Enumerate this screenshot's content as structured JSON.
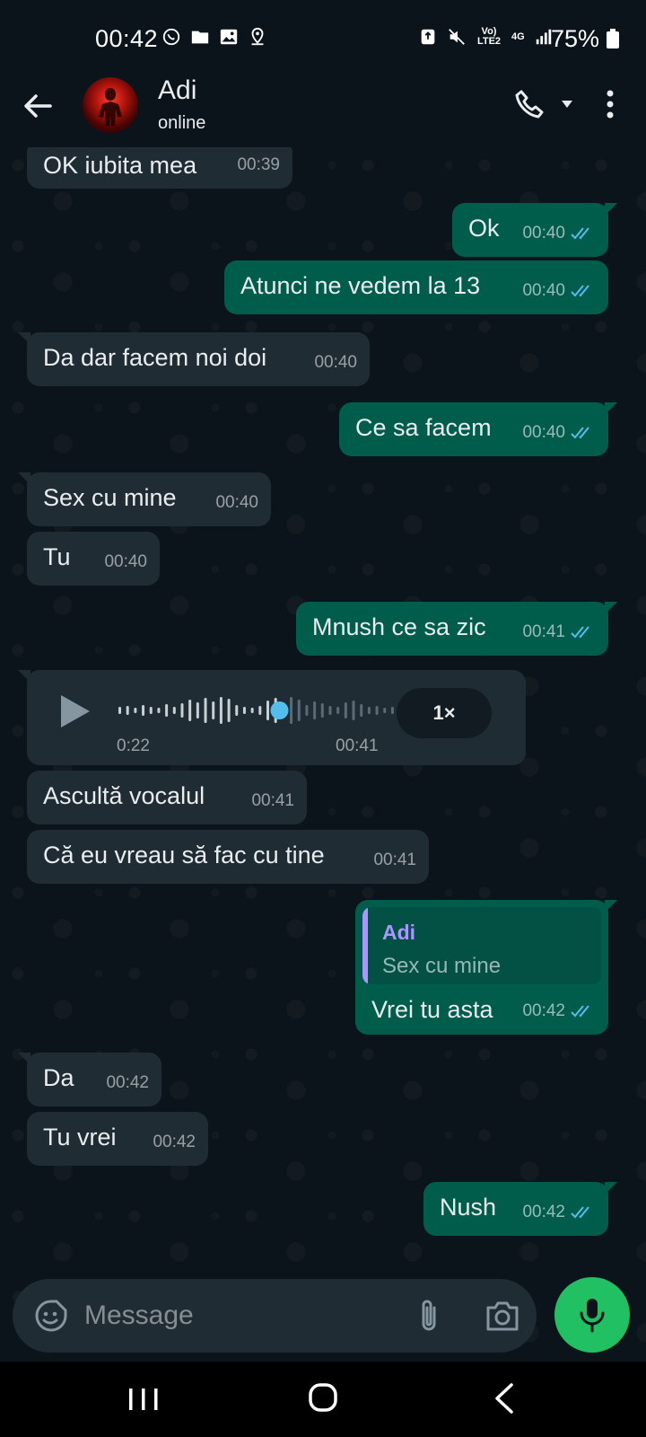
{
  "status_bar": {
    "time": "00:42",
    "battery": "75%",
    "network_label": "Vo) LTE2",
    "network_type": "4G",
    "icons_left": [
      "whatsapp-icon",
      "folder-icon",
      "gallery-icon",
      "location-icon"
    ],
    "icons_right": [
      "recycle-icon",
      "mute-icon",
      "signal-icon",
      "battery-icon"
    ]
  },
  "header": {
    "contact_name": "Adi",
    "contact_status": "online"
  },
  "messages": [
    {
      "dir": "in",
      "text": "OK iubita mea",
      "time": "00:39"
    },
    {
      "dir": "out",
      "text": "Ok",
      "time": "00:40"
    },
    {
      "dir": "out",
      "text": "Atunci ne vedem la 13",
      "time": "00:40"
    },
    {
      "dir": "in",
      "text": "Da dar facem noi doi",
      "time": "00:40"
    },
    {
      "dir": "out",
      "text": "Ce sa facem",
      "time": "00:40"
    },
    {
      "dir": "in",
      "text": "Sex cu mine",
      "time": "00:40"
    },
    {
      "dir": "in",
      "text": "Tu",
      "time": "00:40"
    },
    {
      "dir": "out",
      "text": "Mnush ce sa zic",
      "time": "00:41"
    },
    {
      "dir": "in",
      "text": "Ascultă vocalul",
      "time": "00:41"
    },
    {
      "dir": "in",
      "text": "Că eu vreau să fac cu tine",
      "time": "00:41"
    },
    {
      "dir": "out",
      "text": "Vrei tu asta",
      "time": "00:42"
    },
    {
      "dir": "in",
      "text": "Da",
      "time": "00:42"
    },
    {
      "dir": "in",
      "text": "Tu vrei",
      "time": "00:42"
    },
    {
      "dir": "out",
      "text": "Nush",
      "time": "00:42"
    }
  ],
  "voice_message": {
    "duration": "0:22",
    "time": "00:41",
    "speed": "1×",
    "progress": 0.55
  },
  "reply_quote": {
    "author": "Adi",
    "text": "Sex cu mine"
  },
  "input": {
    "placeholder": "Message"
  },
  "colors": {
    "background": "#0b141a",
    "incoming_bubble": "#202c33",
    "outgoing_bubble": "#005c4b",
    "accent_green": "#21c063",
    "read_ticks": "#53bdeb",
    "quote_author": "#a797ff"
  }
}
